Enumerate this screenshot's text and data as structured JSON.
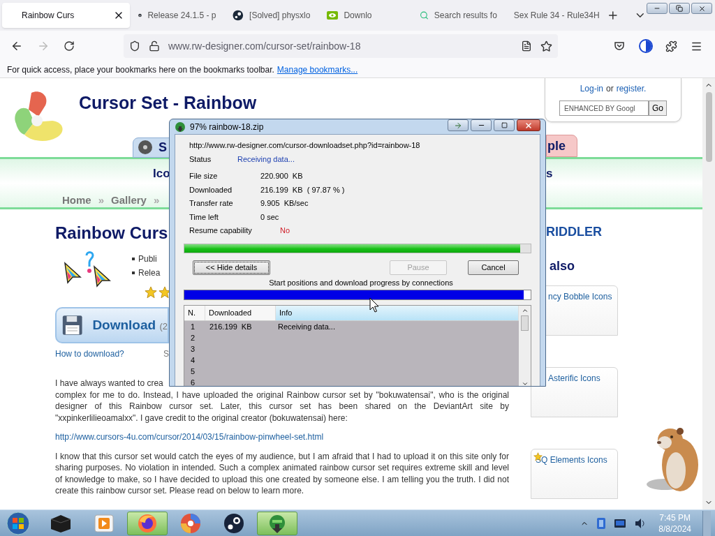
{
  "browser": {
    "tabs": [
      {
        "title": "Rainbow Curs",
        "selected": true,
        "kind": "site"
      },
      {
        "title": "Release 24.1.5 - p",
        "selected": false,
        "kind": "github"
      },
      {
        "title": "[Solved] physxlo",
        "selected": false,
        "kind": "steam"
      },
      {
        "title": "Downlo",
        "selected": false,
        "kind": "nvidia"
      },
      {
        "title": "Search results fo",
        "selected": false,
        "kind": "search"
      },
      {
        "title": "Sex Rule 34 - Rule34H",
        "selected": false,
        "kind": "none"
      }
    ],
    "address": "www.rw-designer.com/cursor-set/rainbow-18",
    "bookmarks_hint": "For quick access, place your bookmarks here on the bookmarks toolbar.",
    "bookmarks_link": "Manage bookmarks..."
  },
  "page": {
    "site_title": "Cursor Set - Rainbow",
    "nav_tabs": [
      {
        "label": "S",
        "color": "#c9dcf0"
      },
      {
        "label": "ple",
        "color": "#f6c8c8"
      }
    ],
    "band_left": "Ico",
    "band_right": "s",
    "breadcrumbs": [
      {
        "label": "Home",
        "separator": "»"
      },
      {
        "label": "Gallery",
        "separator": "»"
      }
    ],
    "heading": "Rainbow Curs",
    "bullets": [
      "Publi",
      "Relea"
    ],
    "download": {
      "label": "Download",
      "extra": "(2"
    },
    "how_to": "How to download?",
    "how_to_side": "S",
    "paragraphs": [
      {
        "kind": "fragment",
        "text": "I have always wanted to crea"
      },
      {
        "kind": "text",
        "text": "complex for me to do. Instead, I have uploaded the original Rainbow cursor set by \"bokuwatensai\", who is the original designer of this Rainbow cursor set. Later, this cursor set has been shared on the DeviantArt site by \"xxpinkerlilieoamalxx\". I gave credit to the original creator (bokuwatensai) here:"
      },
      {
        "kind": "link",
        "text": "http://www.cursors-4u.com/cursor/2014/03/15/rainbow-pinwheel-set.html"
      },
      {
        "kind": "text",
        "text": "I know that this cursor set would catch the eyes of my audience, but I am afraid that I had to upload it on this site only for sharing purposes. No violation in intended. Such a complex animated rainbow cursor set requires extreme skill and level of knowledge to make, so I have decided to upload this one created by someone else. I am telling you the truth. I did not create this rainbow cursor set. Please read on below to learn more."
      }
    ],
    "login": {
      "login": "Log-in",
      "or": "or",
      "register": "register."
    },
    "search": {
      "placeholder": "ENHANCED BY Googl",
      "button": "Go"
    },
    "author_heading": "RIDDLER",
    "see_also_heading": "also",
    "related": [
      {
        "title": "ncy Bobble Icons",
        "starred": false
      },
      {
        "title": "Asterific Icons",
        "starred": false
      },
      {
        "title": "SQ Elements Icons",
        "starred": true
      }
    ]
  },
  "dialog": {
    "title": "97% rainbow-18.zip",
    "url": "http://www.rw-designer.com/cursor-downloadset.php?id=rainbow-18",
    "status": {
      "label": "Status",
      "value": "Receiving data..."
    },
    "details": [
      {
        "label": "File size",
        "value": "220.900  KB",
        "kind": "plain"
      },
      {
        "label": "Downloaded",
        "value": "216.199  KB  ( 97.87 % )",
        "kind": "plain"
      },
      {
        "label": "Transfer rate",
        "value": "9.905  KB/sec",
        "kind": "plain"
      },
      {
        "label": "Time left",
        "value": "0 sec",
        "kind": "plain"
      },
      {
        "label": "Resume capability",
        "value": "No",
        "kind": "warning"
      }
    ],
    "progress": {
      "level": 0.97
    },
    "buttons": [
      {
        "label": "<< Hide details",
        "disabled": false,
        "focused": true
      },
      {
        "label": "Pause",
        "disabled": true,
        "focused": false
      },
      {
        "label": "Cancel",
        "disabled": false,
        "focused": false
      }
    ],
    "connections_caption": "Start positions and download progress by connections",
    "connections_bar": {
      "level": 0.98
    },
    "table": {
      "columns": [
        {
          "label": "N.",
          "highlighted": false
        },
        {
          "label": "Downloaded",
          "highlighted": false
        },
        {
          "label": "Info",
          "highlighted": true
        }
      ],
      "rows": [
        {
          "n": "1",
          "downloaded": "216.199  KB",
          "info": "Receiving data..."
        },
        {
          "n": "2"
        },
        {
          "n": "3"
        },
        {
          "n": "4"
        },
        {
          "n": "5"
        },
        {
          "n": "6"
        }
      ]
    }
  },
  "taskbar": {
    "apps": [
      {
        "kind": "files",
        "active": false
      },
      {
        "kind": "media",
        "active": false
      },
      {
        "kind": "firefox",
        "active": true
      },
      {
        "kind": "swirl",
        "active": false
      },
      {
        "kind": "steam",
        "active": false
      },
      {
        "kind": "idm",
        "active": true
      }
    ],
    "clock": {
      "time": "7:45 PM",
      "date": "8/8/2024"
    }
  }
}
